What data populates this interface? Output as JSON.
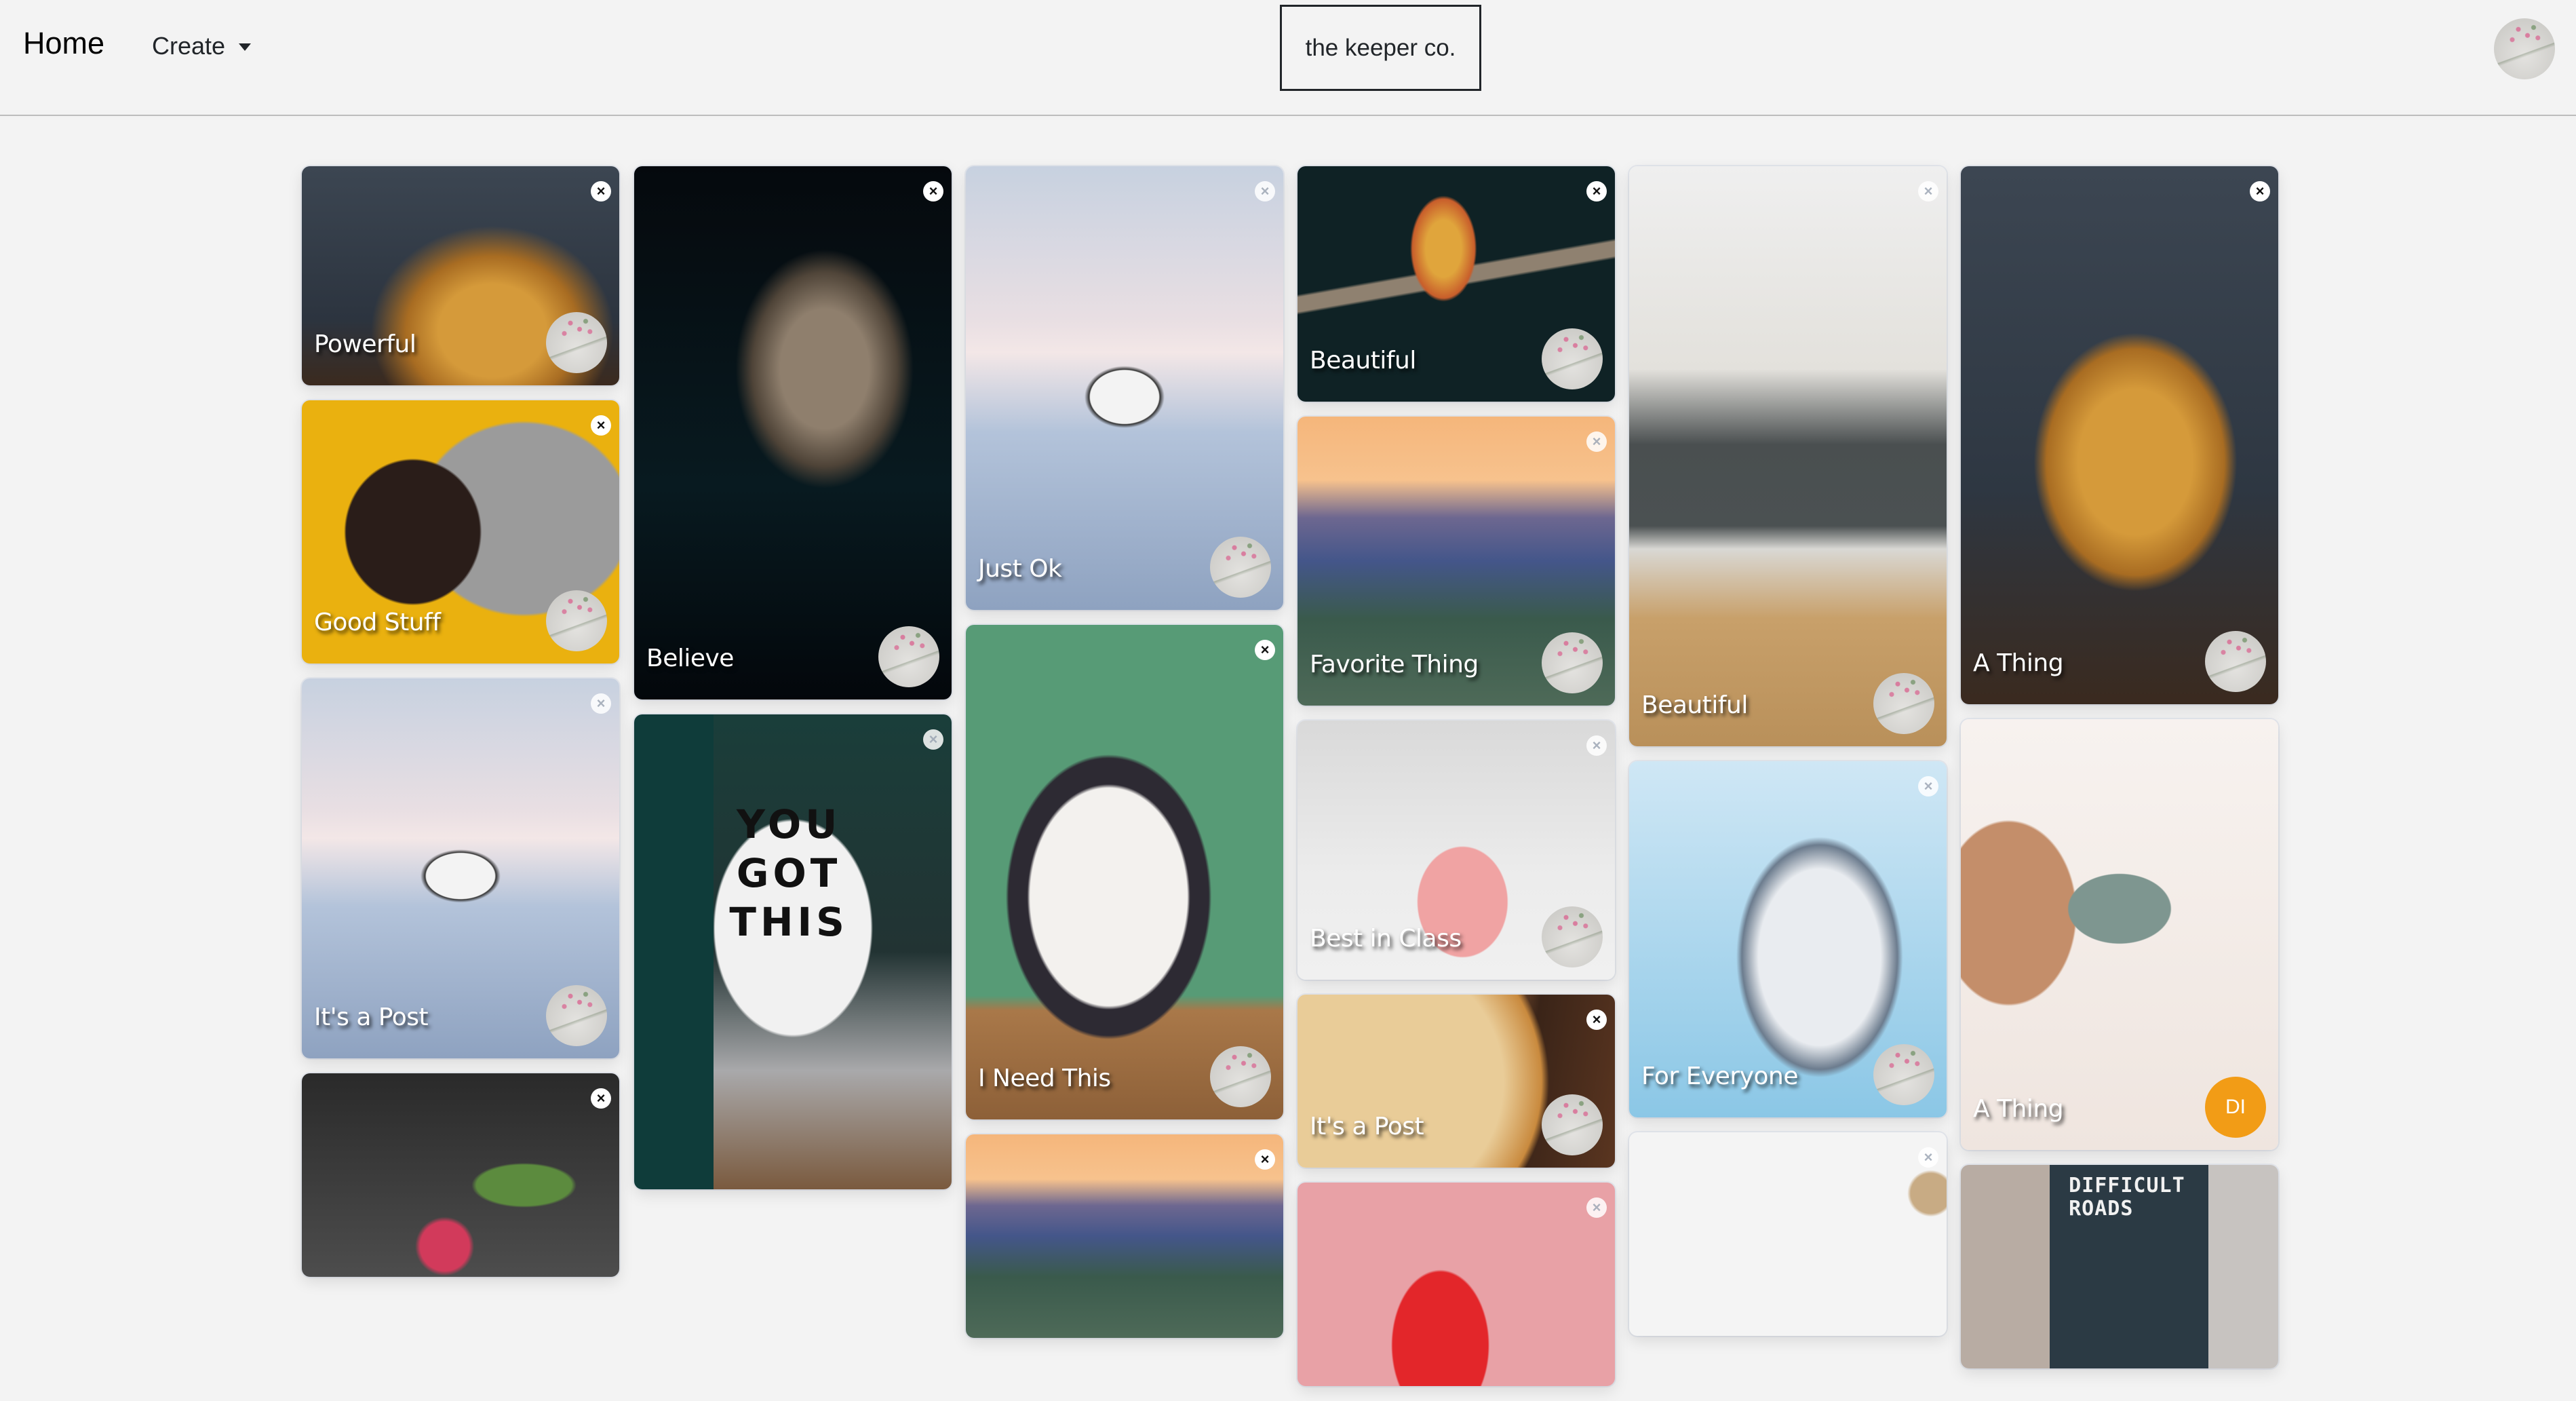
{
  "header": {
    "home_label": "Home",
    "create_label": "Create",
    "brand": "the keeper co.",
    "user_avatar_icon": "user-avatar-flower"
  },
  "icons": {
    "close": "×",
    "caret": "caret-down-icon"
  },
  "columns": [
    {
      "cards": [
        {
          "title": "Powerful",
          "image": "pancakes",
          "close_style": "solid",
          "avatar": "flower"
        },
        {
          "title": "Good Stuff",
          "image": "pug",
          "close_style": "solid",
          "avatar": "flower"
        },
        {
          "title": "It's a Post",
          "image": "snowcar",
          "close_style": "faded",
          "avatar": "flower"
        },
        {
          "title": "",
          "image": "raspberry",
          "close_style": "solid",
          "avatar": ""
        }
      ]
    },
    {
      "cards": [
        {
          "title": "Believe",
          "image": "wolf",
          "close_style": "solid",
          "avatar": "flower"
        },
        {
          "title": "",
          "image": "yougotthis",
          "image_text": [
            "YOU",
            "GOT",
            "THIS"
          ],
          "close_style": "faded",
          "avatar": ""
        }
      ]
    },
    {
      "cards": [
        {
          "title": "Just Ok",
          "image": "snowcar",
          "close_style": "faded",
          "avatar": "flower"
        },
        {
          "title": "I Need This",
          "image": "cat",
          "close_style": "solid",
          "avatar": "flower"
        },
        {
          "title": "",
          "image": "sunset",
          "close_style": "solid",
          "avatar": ""
        }
      ]
    },
    {
      "cards": [
        {
          "title": "Beautiful",
          "image": "parrot",
          "close_style": "solid",
          "avatar": "flower"
        },
        {
          "title": "Favorite Thing",
          "image": "sunset",
          "close_style": "faded",
          "avatar": "flower"
        },
        {
          "title": "Best in Class",
          "image": "dino",
          "close_style": "faded",
          "avatar": "flower"
        },
        {
          "title": "It's a Post",
          "image": "pizza",
          "close_style": "solid",
          "avatar": "flower"
        },
        {
          "title": "",
          "image": "mario",
          "close_style": "faded",
          "avatar": ""
        }
      ]
    },
    {
      "cards": [
        {
          "title": "Beautiful",
          "image": "kitchen",
          "close_style": "faded",
          "avatar": "flower"
        },
        {
          "title": "For Everyone",
          "image": "robot",
          "close_style": "faded",
          "avatar": "flower"
        },
        {
          "title": "",
          "image": "scrabble",
          "close_style": "faded",
          "avatar": ""
        }
      ]
    },
    {
      "cards": [
        {
          "title": "A Thing",
          "image": "pancakes-tall",
          "close_style": "solid",
          "avatar": "flower"
        },
        {
          "title": "A Thing",
          "image": "soap",
          "close_style": "none",
          "avatar": "initials",
          "avatar_initials": "DI",
          "avatar_color": "#f29c16"
        },
        {
          "title": "",
          "image": "difficult",
          "image_text": [
            "DIFFICULT",
            "ROADS"
          ],
          "close_style": "none",
          "avatar": ""
        }
      ]
    }
  ]
}
